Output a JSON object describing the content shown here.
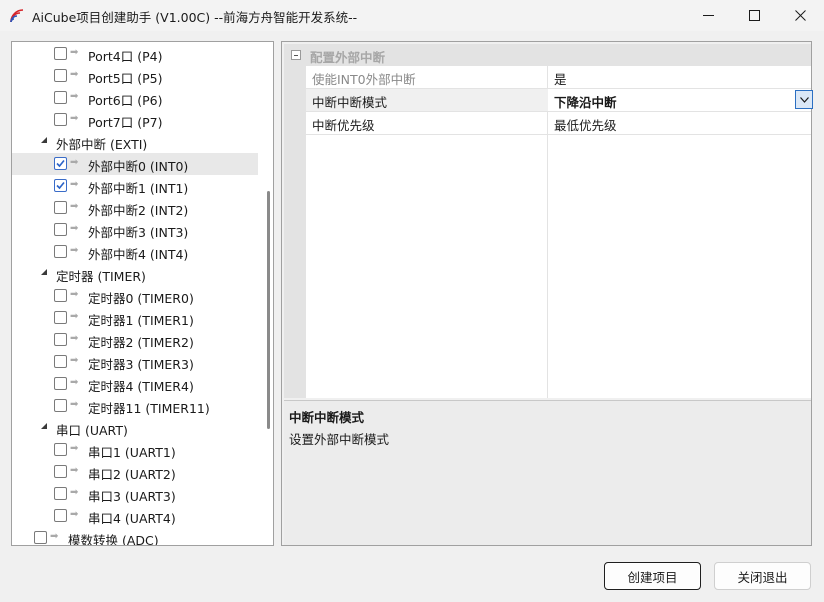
{
  "window": {
    "title": "AiCube项目创建助手 (V1.00C) --前海方舟智能开发系统--"
  },
  "tree": {
    "items": [
      {
        "label": "Port4口 (P4)",
        "checked": false
      },
      {
        "label": "Port5口 (P5)",
        "checked": false
      },
      {
        "label": "Port6口 (P6)",
        "checked": false
      },
      {
        "label": "Port7口 (P7)",
        "checked": false
      },
      {
        "label": "外部中断 (EXTI)",
        "group": true
      },
      {
        "label": "外部中断0 (INT0)",
        "checked": true,
        "selected": true
      },
      {
        "label": "外部中断1 (INT1)",
        "checked": true
      },
      {
        "label": "外部中断2 (INT2)",
        "checked": false
      },
      {
        "label": "外部中断3 (INT3)",
        "checked": false
      },
      {
        "label": "外部中断4 (INT4)",
        "checked": false
      },
      {
        "label": "定时器 (TIMER)",
        "group": true
      },
      {
        "label": "定时器0 (TIMER0)",
        "checked": false
      },
      {
        "label": "定时器1 (TIMER1)",
        "checked": false
      },
      {
        "label": "定时器2 (TIMER2)",
        "checked": false
      },
      {
        "label": "定时器3 (TIMER3)",
        "checked": false
      },
      {
        "label": "定时器4 (TIMER4)",
        "checked": false
      },
      {
        "label": "定时器11 (TIMER11)",
        "checked": false
      },
      {
        "label": "串口 (UART)",
        "group": true
      },
      {
        "label": "串口1 (UART1)",
        "checked": false
      },
      {
        "label": "串口2 (UART2)",
        "checked": false
      },
      {
        "label": "串口3 (UART3)",
        "checked": false
      },
      {
        "label": "串口4 (UART4)",
        "checked": false
      },
      {
        "label": "模数转换 (ADC)",
        "checked": false,
        "top_level": true
      }
    ]
  },
  "properties": {
    "category": "配置外部中断",
    "rows": [
      {
        "name": "使能INT0外部中断",
        "value": "是"
      },
      {
        "name": "中断中断模式",
        "value": "下降沿中断"
      },
      {
        "name": "中断优先级",
        "value": "最低优先级"
      }
    ],
    "description": {
      "title": "中断中断模式",
      "text": "设置外部中断模式"
    }
  },
  "buttons": {
    "create": "创建项目",
    "exit": "关闭退出"
  },
  "colors": {
    "checkbox_accent": "#2b63c8",
    "dropdown_border": "#2b6fc2"
  }
}
